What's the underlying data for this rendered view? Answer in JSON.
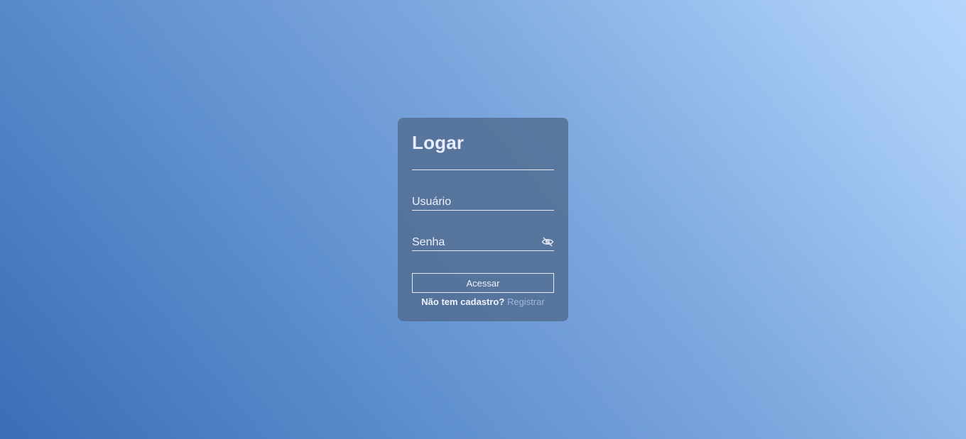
{
  "login_card": {
    "title": "Logar",
    "username": {
      "placeholder": "Usuário",
      "value": ""
    },
    "password": {
      "placeholder": "Senha",
      "value": "",
      "toggle_icon": "eye-slash-icon"
    },
    "submit_label": "Acessar",
    "register_prompt": "Não tem cadastro?",
    "register_link": "Registrar"
  },
  "colors": {
    "card_bg": "#5a7499",
    "text": "#eef1fb",
    "link": "#9fb8d8",
    "gradient_start": "#3a6db5",
    "gradient_end": "#b5d6fb"
  }
}
